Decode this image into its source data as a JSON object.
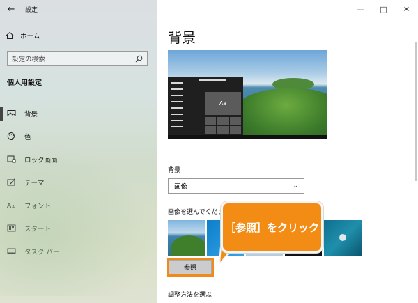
{
  "window": {
    "app_title": "設定",
    "back_icon": "back-arrow-icon"
  },
  "sidebar": {
    "home_label": "ホーム",
    "search_placeholder": "設定の検索",
    "section_title": "個人用設定",
    "items": [
      {
        "label": "背景",
        "icon": "picture-icon",
        "active": true
      },
      {
        "label": "色",
        "icon": "palette-icon",
        "active": false
      },
      {
        "label": "ロック画面",
        "icon": "lock-screen-icon",
        "active": false
      },
      {
        "label": "テーマ",
        "icon": "brush-icon",
        "active": false
      },
      {
        "label": "フォント",
        "icon": "font-icon",
        "active": false
      },
      {
        "label": "スタート",
        "icon": "start-icon",
        "active": false
      },
      {
        "label": "タスク バー",
        "icon": "taskbar-icon",
        "active": false
      }
    ]
  },
  "main": {
    "title": "背景",
    "preview_tile_label": "Aa",
    "background_label": "背景",
    "background_select_value": "画像",
    "choose_image_label": "画像を選んでください",
    "browse_button": "参照",
    "fit_label": "調整方法を選ぶ"
  },
  "callout": {
    "text": "［参照］をクリック",
    "color": "#f28c14"
  }
}
